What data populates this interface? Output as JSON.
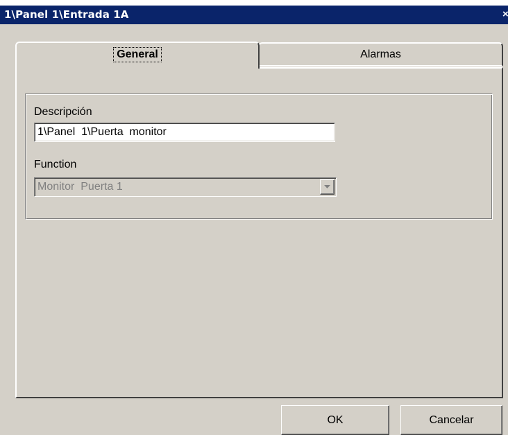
{
  "window": {
    "title": "1\\Panel  1\\Entrada 1A",
    "close_glyph": "×"
  },
  "tabs": [
    {
      "label": "General",
      "selected": true
    },
    {
      "label": "Alarmas",
      "selected": false
    }
  ],
  "general": {
    "description_label": "Descripción",
    "description_value": "1\\Panel  1\\Puerta  monitor",
    "function_label": "Function",
    "function_value": "Monitor  Puerta 1",
    "function_enabled": false
  },
  "buttons": {
    "ok_label": "OK",
    "cancel_label": "Cancelar"
  },
  "colors": {
    "title_bar": "#0a246a",
    "dialog_face": "#d4d0c8",
    "disabled_text": "#808080"
  },
  "icons": {
    "close": "close-icon",
    "dropdown": "chevron-down-icon"
  }
}
